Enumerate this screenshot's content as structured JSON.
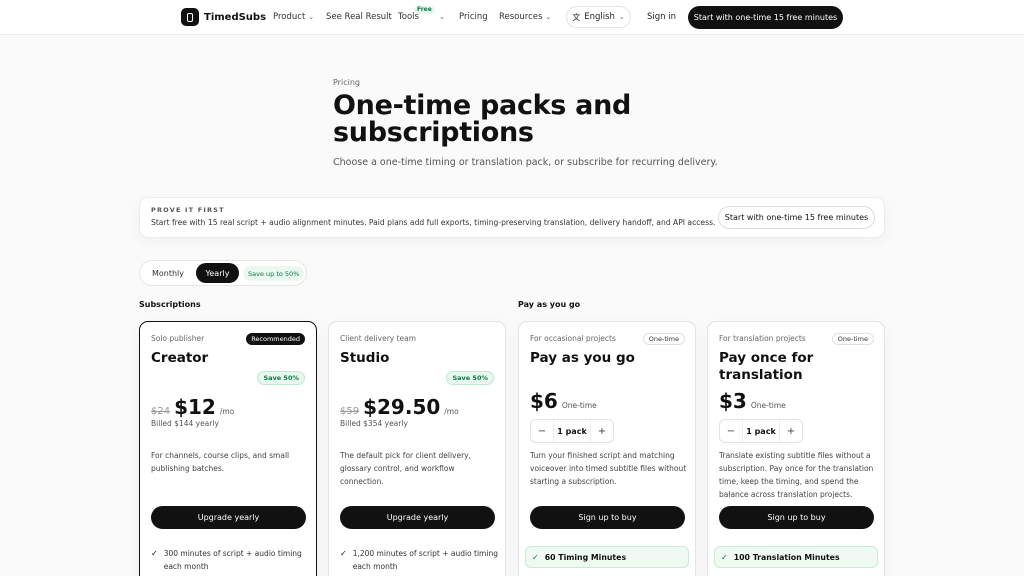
{
  "nav": {
    "brand": "TimedSubs",
    "product": "Product",
    "see_real_result": "See Real Result",
    "tools": "Tools",
    "tools_badge": "Free",
    "pricing": "Pricing",
    "resources": "Resources",
    "language": "English",
    "sign_in": "Sign in",
    "cta": "Start with one-time 15 free minutes"
  },
  "hero": {
    "eyebrow": "Pricing",
    "title": "One-time packs and subscriptions",
    "subtitle": "Choose a one-time timing or translation pack, or subscribe for recurring delivery."
  },
  "prove": {
    "title": "PROVE IT FIRST",
    "text": "Start free with 15 real script + audio alignment minutes. Paid plans add full exports, timing-preserving translation, delivery handoff, and API access.",
    "cta": "Start with one-time 15 free minutes"
  },
  "billing_toggle": {
    "monthly": "Monthly",
    "yearly": "Yearly",
    "selected": "Yearly",
    "save": "Save up to 50%"
  },
  "sections": {
    "subscriptions": "Subscriptions",
    "pay_as_you_go": "Pay as you go"
  },
  "cards": [
    {
      "kicker": "Solo publisher",
      "title": "Creator",
      "badge": "Recommended",
      "save": "Save 50%",
      "old_price": "$24",
      "price": "$12",
      "per": "/mo",
      "billed": "Billed $144 yearly",
      "desc": "For channels, course clips, and small publishing batches.",
      "cta": "Upgrade yearly",
      "feature": "300 minutes of script + audio timing each month"
    },
    {
      "kicker": "Client delivery team",
      "title": "Studio",
      "save": "Save 50%",
      "old_price": "$59",
      "price": "$29.50",
      "per": "/mo",
      "billed": "Billed $354 yearly",
      "desc": "The default pick for client delivery, glossary control, and workflow connection.",
      "cta": "Upgrade yearly",
      "feature": "1,200 minutes of script + audio timing each month"
    },
    {
      "kicker": "For occasional projects",
      "title": "Pay as you go",
      "badge": "One-time",
      "price": "$6",
      "per": "One-time",
      "stepper": {
        "minus": "−",
        "value": "1 pack",
        "plus": "+"
      },
      "desc": "Turn your finished script and matching voiceover into timed subtitle files without starting a subscription.",
      "cta": "Sign up to buy",
      "feature": "60 Timing Minutes"
    },
    {
      "kicker": "For translation projects",
      "title": "Pay once for translation",
      "badge": "One-time",
      "price": "$3",
      "per": "One-time",
      "stepper": {
        "minus": "−",
        "value": "1 pack",
        "plus": "+"
      },
      "desc": "Translate existing subtitle files without a subscription. Pay once for the translation time, keep the timing, and spend the balance across translation projects.",
      "cta": "Sign up to buy",
      "feature": "100 Translation Minutes"
    }
  ],
  "icons": {
    "logo": "logo-icon",
    "chevron": "chevron-down-icon",
    "translate": "translate-icon",
    "check": "check-icon"
  },
  "colors": {
    "primary": "#111111",
    "accent_green": "#0a7a43",
    "green_bg": "#eefaf2"
  }
}
